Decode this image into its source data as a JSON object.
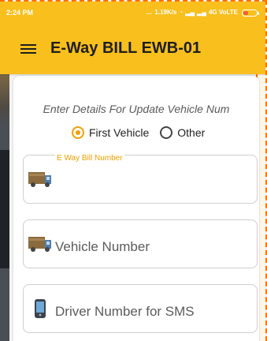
{
  "status_bar": {
    "time": "2:24 PM",
    "network_speed": "1.19K/s",
    "network_label": "4G VoLTE",
    "battery_level": 0.35
  },
  "app_bar": {
    "title": "E-Way BILL EWB-01",
    "menu_icon": "hamburger-menu-icon"
  },
  "form": {
    "prompt": "Enter Details For Update Vehicle Num",
    "radio_options": [
      {
        "label": "First Vehicle",
        "selected": true
      },
      {
        "label": "Other",
        "selected": false
      }
    ],
    "fields": [
      {
        "label": "E Way Bill Number",
        "value": "",
        "icon": "truck-icon"
      },
      {
        "label": "",
        "placeholder": "Vehicle Number",
        "icon": "truck-icon"
      },
      {
        "label": "",
        "placeholder": "Driver Number for SMS",
        "icon": "mobile-phone-icon"
      }
    ]
  },
  "colors": {
    "accent": "#F8BF1D",
    "radio_selected": "#F0A000",
    "label_accent": "#F0A000"
  }
}
